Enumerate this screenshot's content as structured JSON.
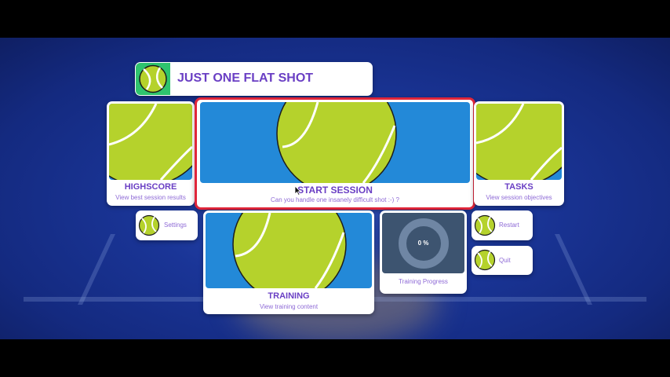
{
  "header": {
    "title": "JUST ONE FLAT SHOT"
  },
  "cards": {
    "highscore": {
      "title": "HIGHSCORE",
      "subtitle": "View best session results"
    },
    "start_session": {
      "title": "START SESSION",
      "subtitle": "Can you handle one insanely difficult shot :-) ?"
    },
    "tasks": {
      "title": "TASKS",
      "subtitle": "View session objectives"
    },
    "training": {
      "title": "TRAINING",
      "subtitle": "View training content"
    },
    "progress": {
      "value_label": "0 %",
      "value": 0,
      "label": "Training Progress"
    }
  },
  "buttons": {
    "settings": "Settings",
    "restart": "Restart",
    "quit": "Quit"
  },
  "colors": {
    "accent_purple": "#6a3fc4",
    "selection_red": "#e0263a",
    "tile_blue": "#2389d8",
    "ball_green": "#b5d22c"
  },
  "icons": [
    "tennis-ball-icon",
    "mouse-cursor-icon"
  ]
}
